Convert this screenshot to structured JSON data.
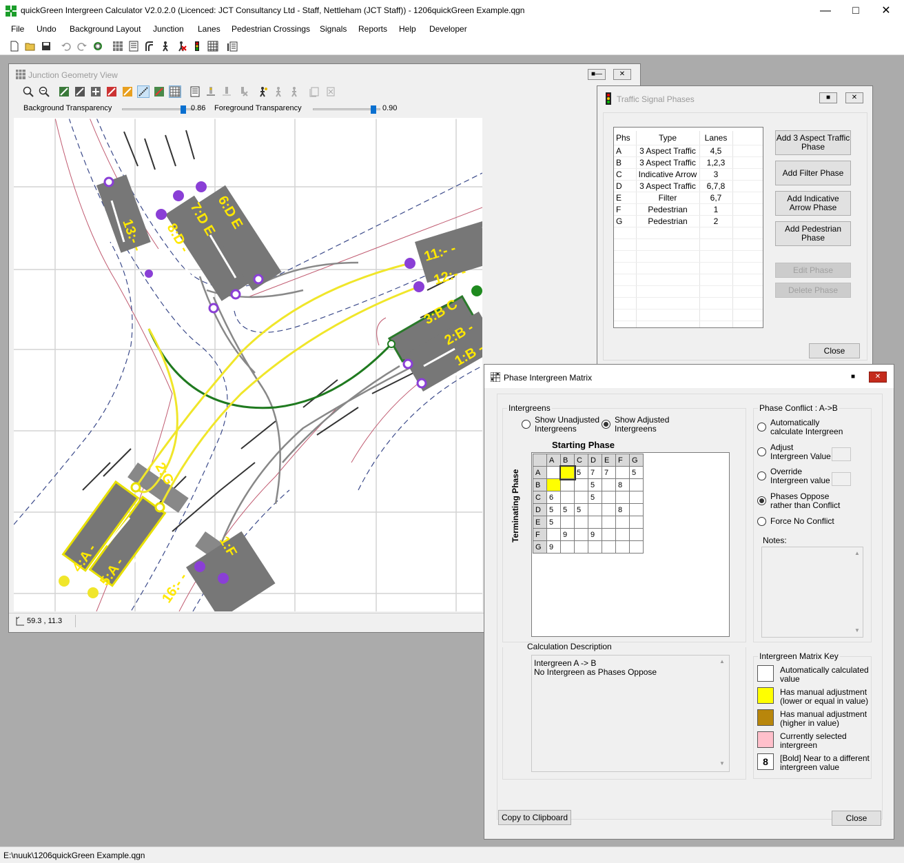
{
  "app": {
    "title": "quickGreen Intergreen Calculator V2.0.2.0  (Licenced: JCT Consultancy Ltd - Staff, Nettleham (JCT Staff)) - 1206quickGreen Example.qgn"
  },
  "menu": [
    "File",
    "Undo",
    "Background Layout",
    "Junction",
    "Lanes",
    "Pedestrian Crossings",
    "Signals",
    "Reports",
    "Help",
    "Developer"
  ],
  "junction_window": {
    "title": "Junction Geometry View",
    "background_transparency_label": "Background Transparency",
    "background_transparency_value": "0.86",
    "background_transparency_level": 0.86,
    "foreground_transparency_label": "Foreground Transparency",
    "foreground_transparency_value": "0.90",
    "foreground_transparency_level": 0.9,
    "coordinates": "59.3 , 11.3",
    "stream_labels": [
      "13:- -",
      "8:D -",
      "7:D E",
      "6:D E",
      "11:- -",
      "12:- -",
      "3:B C",
      "2:B -",
      "1:B -",
      "2:G",
      "4:A -",
      "5:A -",
      "1:F",
      "16:- -"
    ]
  },
  "phases_window": {
    "title": "Traffic Signal Phases",
    "columns": [
      "Phs",
      "Type",
      "Lanes"
    ],
    "rows": [
      {
        "phs": "A",
        "type": "3 Aspect Traffic",
        "lanes": "4,5"
      },
      {
        "phs": "B",
        "type": "3 Aspect Traffic",
        "lanes": "1,2,3"
      },
      {
        "phs": "C",
        "type": "Indicative Arrow",
        "lanes": "3"
      },
      {
        "phs": "D",
        "type": "3 Aspect Traffic",
        "lanes": "6,7,8"
      },
      {
        "phs": "E",
        "type": "Filter",
        "lanes": "6,7"
      },
      {
        "phs": "F",
        "type": "Pedestrian",
        "lanes": "1"
      },
      {
        "phs": "G",
        "type": "Pedestrian",
        "lanes": "2"
      }
    ],
    "buttons": {
      "add_3_aspect_l1": "Add 3 Aspect Traffic",
      "add_3_aspect_l2": "Phase",
      "add_filter": "Add Filter Phase",
      "add_indicative_l1": "Add Indicative",
      "add_indicative_l2": "Arrow Phase",
      "add_pedestrian_l1": "Add Pedestrian",
      "add_pedestrian_l2": "Phase",
      "edit": "Edit Phase",
      "delete": "Delete Phase",
      "close": "Close"
    }
  },
  "intergreen_window": {
    "title": "Phase Intergreen Matrix",
    "intergreens_group": "Intergreens",
    "show_unadjusted_l1": "Show Unadjusted",
    "show_unadjusted_l2": "Intergreens",
    "show_adjusted_l1": "Show Adjusted",
    "show_adjusted_l2": "Intergreens",
    "starting_phase": "Starting Phase",
    "terminating_phase": "Terminating Phase",
    "matrix_headers": [
      "A",
      "B",
      "C",
      "D",
      "E",
      "F",
      "G"
    ],
    "matrix": [
      [
        "",
        "",
        "5",
        "7",
        "7",
        "",
        "5"
      ],
      [
        "",
        "",
        "",
        "5",
        "",
        "8",
        ""
      ],
      [
        "6",
        "",
        "",
        "5",
        "",
        "",
        ""
      ],
      [
        "5",
        "5",
        "5",
        "",
        "",
        "8",
        ""
      ],
      [
        "5",
        "",
        "",
        "",
        "",
        "",
        ""
      ],
      [
        "",
        "9",
        "",
        "9",
        "",
        "",
        ""
      ],
      [
        "9",
        "",
        "",
        "",
        "",
        "",
        ""
      ]
    ],
    "calc_desc_label": "Calculation Description",
    "calc_desc_line1": "Intergreen A -> B",
    "calc_desc_line2": "No Intergreen as Phases Oppose",
    "conflict_group": "Phase Conflict : A->B",
    "opt_auto_l1": "Automatically",
    "opt_auto_l2": "calculate Intergreen",
    "opt_adjust_l1": "Adjust",
    "opt_adjust_l2": "Intergreen Value",
    "opt_override_l1": "Override",
    "opt_override_l2": "Intergreen value",
    "opt_oppose_l1": "Phases Oppose",
    "opt_oppose_l2": "rather than Conflict",
    "opt_force": "Force No Conflict",
    "notes_label": "Notes:",
    "key_group": "Intergreen Matrix Key",
    "key1_l1": "Automatically calculated",
    "key1_l2": "value",
    "key2_l1": "Has manual adjustment",
    "key2_l2": "(lower or equal in value)",
    "key3_l1": "Has manual adjustment",
    "key3_l2": "(higher in value)",
    "key4_l1": "Currently selected",
    "key4_l2": "intergreen",
    "key5_l1": "[Bold] Near to a different",
    "key5_l2": "intergreen value",
    "key5_sample": "8",
    "copy_button": "Copy to Clipboard",
    "close_button": "Close",
    "colors": {
      "auto": "#ffffff",
      "lower": "#ffff00",
      "higher": "#b8860b",
      "selected": "#ffc0cb"
    }
  },
  "status_bar": "E:\\nuuk\\1206quickGreen Example.qgn"
}
